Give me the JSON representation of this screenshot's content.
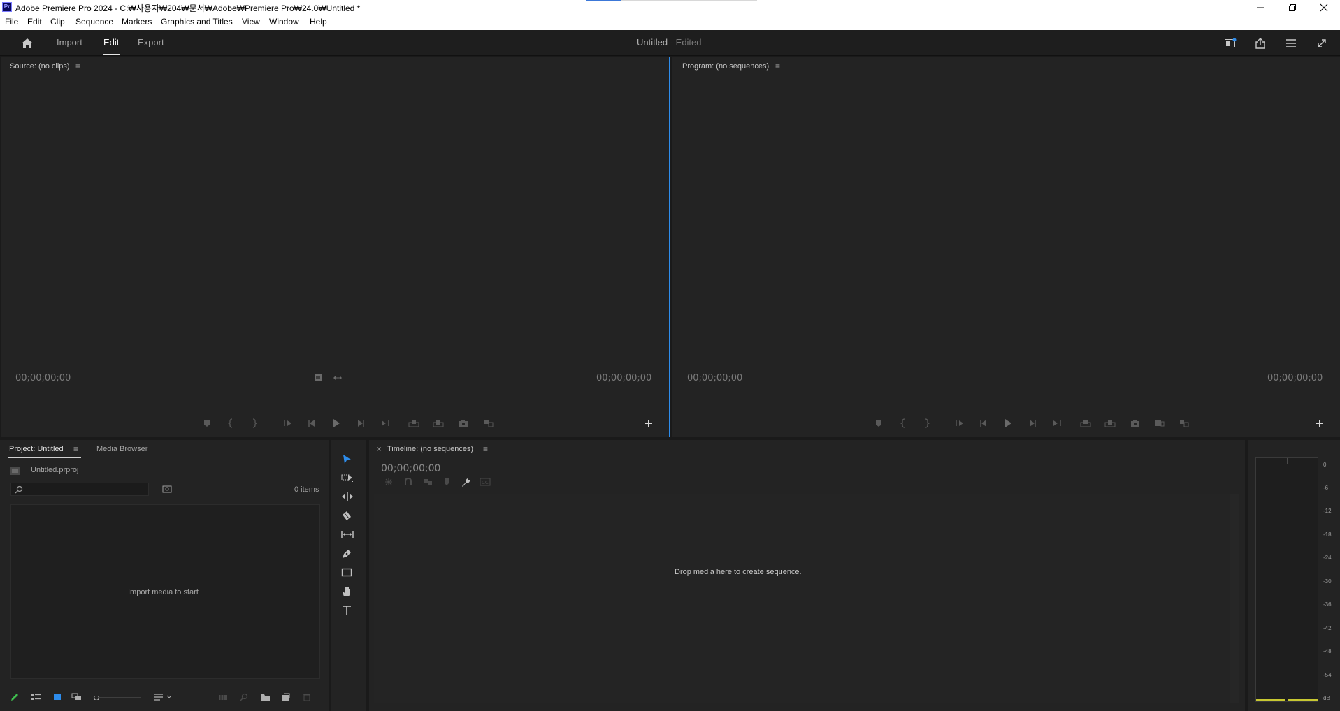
{
  "window": {
    "title": "Adobe Premiere Pro 2024 - C:₩사용자₩204₩문서₩Adobe₩Premiere Pro₩24.0₩Untitled *",
    "app_icon_label": "Pr"
  },
  "menu": [
    "File",
    "Edit",
    "Clip",
    "Sequence",
    "Markers",
    "Graphics and Titles",
    "View",
    "Window",
    "Help"
  ],
  "header": {
    "tabs": [
      "Import",
      "Edit",
      "Export"
    ],
    "active_tab": "Edit",
    "doc_title": "Untitled",
    "doc_status": "- Edited"
  },
  "source": {
    "title": "Source: (no clips)",
    "timecode_left": "00;00;00;00",
    "timecode_right": "00;00;00;00"
  },
  "program": {
    "title": "Program: (no sequences)",
    "timecode_left": "00;00;00;00",
    "timecode_right": "00;00;00;00"
  },
  "project": {
    "tabs": [
      "Project: Untitled",
      "Media Browser"
    ],
    "file_name": "Untitled.prproj",
    "search_placeholder": "",
    "item_count": "0 items",
    "empty_message": "Import media to start"
  },
  "timeline": {
    "title": "Timeline: (no sequences)",
    "close_glyph": "×",
    "timecode": "00;00;00;00",
    "empty_message": "Drop media here to create sequence."
  },
  "meter": {
    "scale": [
      "0",
      "-6",
      "-12",
      "-18",
      "-24",
      "-30",
      "-36",
      "-42",
      "-48",
      "-54",
      "dB"
    ]
  },
  "colors": {
    "accent_blue": "#2d8ceb",
    "panel_bg": "#232323",
    "meter_level": "#c8c832"
  }
}
